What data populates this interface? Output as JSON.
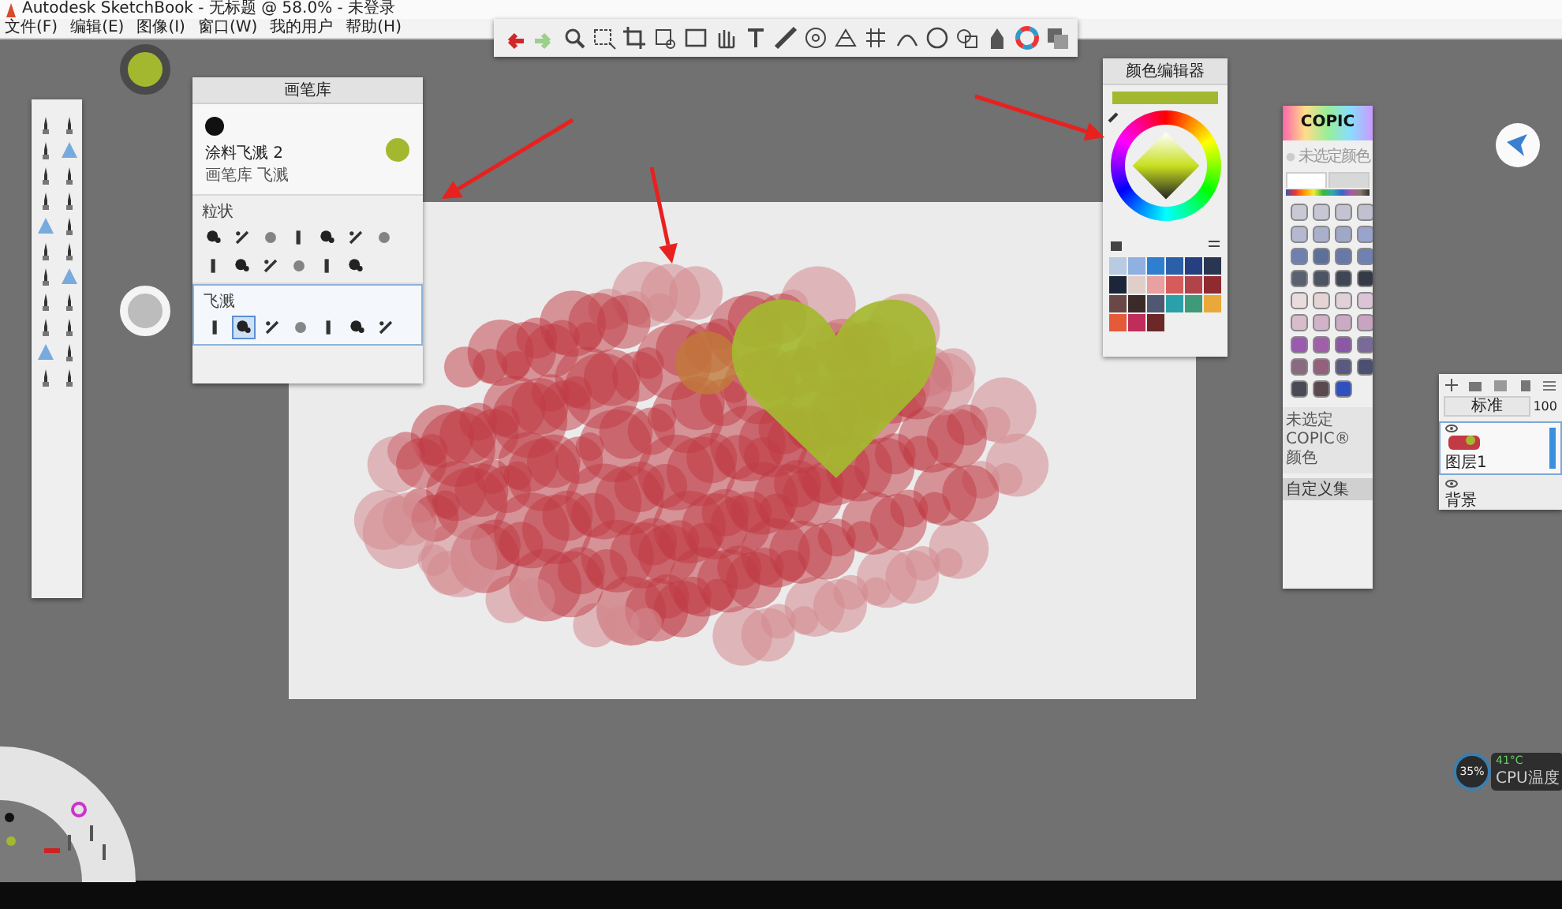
{
  "window": {
    "title": "Autodesk SketchBook - 无标题 @ 58.0% - 未登录"
  },
  "menu": [
    {
      "label": "文件(F)"
    },
    {
      "label": "编辑(E)"
    },
    {
      "label": "图像(I)"
    },
    {
      "label": "窗口(W)"
    },
    {
      "label": "我的用户"
    },
    {
      "label": "帮助(H)"
    }
  ],
  "brush_library": {
    "title": "画笔库",
    "brush_name": "涂料飞溅 2",
    "brush_path": "画笔库  飞溅",
    "sections": [
      {
        "label": "粒状",
        "brushes": [
          {
            "selected": false
          },
          {
            "selected": false
          },
          {
            "selected": false
          },
          {
            "selected": false
          },
          {
            "selected": false
          },
          {
            "selected": false
          },
          {
            "selected": false
          },
          {
            "selected": false
          },
          {
            "selected": false
          },
          {
            "selected": false
          },
          {
            "selected": false
          },
          {
            "selected": false
          },
          {
            "selected": false
          }
        ]
      },
      {
        "label": "飞溅",
        "brushes": [
          {
            "selected": false
          },
          {
            "selected": true
          },
          {
            "selected": false
          },
          {
            "selected": false
          },
          {
            "selected": false
          },
          {
            "selected": false
          },
          {
            "selected": false
          }
        ]
      }
    ]
  },
  "color_editor": {
    "title": "颜色编辑器",
    "swatches": [
      {
        "color": "#b8cbe0"
      },
      {
        "color": "#8fb0e0"
      },
      {
        "color": "#2f7fd0"
      },
      {
        "color": "#2b5fa8"
      },
      {
        "color": "#253f80"
      },
      {
        "color": "#283650"
      },
      {
        "color": "#1c2638"
      },
      {
        "color": "#e0cfc9"
      },
      {
        "color": "#e8a0a0"
      },
      {
        "color": "#d65c5c"
      },
      {
        "color": "#b0444a"
      },
      {
        "color": "#8f2b30"
      },
      {
        "color": "#6b4848"
      },
      {
        "color": "#3a2a2a"
      },
      {
        "color": "#4f5870"
      },
      {
        "color": "#2aa0a8"
      },
      {
        "color": "#3f9a7a"
      },
      {
        "color": "#e8a83a"
      },
      {
        "color": "#e55a3a"
      },
      {
        "color": "#c02d5a"
      },
      {
        "color": "#6a2828"
      }
    ]
  },
  "copic": {
    "logo": "COPIC",
    "status_top": "未选定颜色",
    "tabs": [
      {
        "selected": true
      },
      {
        "selected": false
      }
    ],
    "markers": [
      {
        "color": "#c9c9d6"
      },
      {
        "color": "#c6c6d4"
      },
      {
        "color": "#c3c3d2"
      },
      {
        "color": "#c0c0d0"
      },
      {
        "color": "#b4b8d0"
      },
      {
        "color": "#aab0cc"
      },
      {
        "color": "#a0a8c8"
      },
      {
        "color": "#98a4cc"
      },
      {
        "color": "#6f80b0"
      },
      {
        "color": "#5f7098"
      },
      {
        "color": "#6878a8"
      },
      {
        "color": "#7080b0"
      },
      {
        "color": "#5a6272"
      },
      {
        "color": "#4c5464"
      },
      {
        "color": "#3f4654"
      },
      {
        "color": "#343a46"
      },
      {
        "color": "#e8dcdc"
      },
      {
        "color": "#e4d4d4"
      },
      {
        "color": "#e0d0d8"
      },
      {
        "color": "#dcc4d8"
      },
      {
        "color": "#d8bccc"
      },
      {
        "color": "#d2b2c8"
      },
      {
        "color": "#ccaac4"
      },
      {
        "color": "#c8a4c0"
      },
      {
        "color": "#9a5ab0"
      },
      {
        "color": "#a060a8"
      },
      {
        "color": "#8a58a4"
      },
      {
        "color": "#7a6a9a"
      },
      {
        "color": "#8a6a80"
      },
      {
        "color": "#94607c"
      },
      {
        "color": "#5a5a80"
      },
      {
        "color": "#4c5070"
      },
      {
        "color": "#4a4a56"
      },
      {
        "color": "#5a4a50"
      },
      {
        "color": "#3050c0"
      }
    ],
    "status": "未选定 COPIC® 颜色",
    "footer": "自定义集"
  },
  "layers": {
    "blend_mode": "标准",
    "opacity": "100",
    "layers": [
      {
        "name": "图层1",
        "selected": true,
        "level": 1
      },
      {
        "name": "背景",
        "selected": false
      }
    ]
  },
  "cpu_widget": {
    "percent": "35%",
    "temperature": "41°C",
    "label": "CPU温度"
  }
}
